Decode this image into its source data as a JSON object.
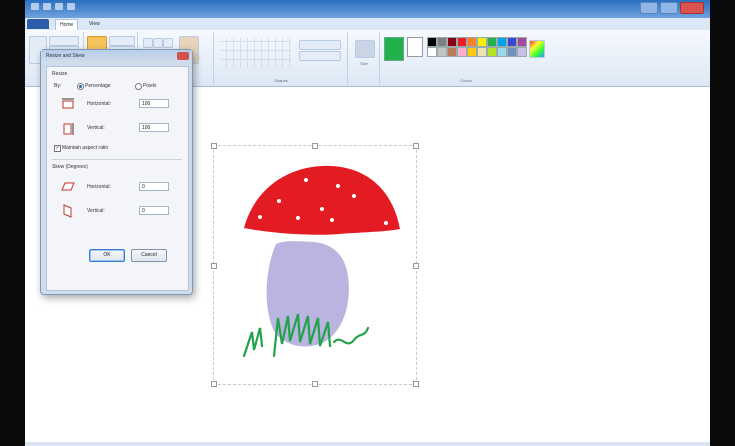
{
  "window": {
    "tabs": [
      "Home",
      "View"
    ]
  },
  "ribbon": {
    "groups": {
      "shapes": "Shapes",
      "colors": "Colors"
    },
    "buttons": {
      "size": "Size",
      "color1": "Color 1",
      "color2": "Color 2",
      "edit_colors": "Edit colors"
    },
    "palette": [
      "#000000",
      "#7f7f7f",
      "#880015",
      "#ed1c24",
      "#ff7f27",
      "#fff200",
      "#22b14c",
      "#00a2e8",
      "#3f48cc",
      "#a349a4",
      "#ffffff",
      "#c3c3c3",
      "#b97a57",
      "#ffaec9",
      "#ffc90e",
      "#efe4b0",
      "#b5e61d",
      "#99d9ea",
      "#7092be",
      "#c8bfe7"
    ],
    "accent": "#2b5da8"
  },
  "dialog": {
    "title": "Resize and Skew",
    "resize_section": "Resize",
    "by_label": "By:",
    "percentage_label": "Percentage",
    "pixels_label": "Pixels",
    "resize_horizontal_label": "Horizontal:",
    "resize_horizontal_value": "100",
    "resize_vertical_label": "Vertical:",
    "resize_vertical_value": "100",
    "maintain_aspect_label": "Maintain aspect ratio",
    "skew_section": "Skew (Degrees)",
    "skew_horizontal_label": "Horizontal:",
    "skew_horizontal_value": "0",
    "skew_vertical_label": "Vertical:",
    "skew_vertical_value": "0",
    "ok_label": "OK",
    "cancel_label": "Cancel"
  },
  "drawing": {
    "cap_color": "#e31b23",
    "stem_color": "#b9b5e0",
    "grass_color": "#22a24a",
    "dot_color": "#ffffff"
  }
}
